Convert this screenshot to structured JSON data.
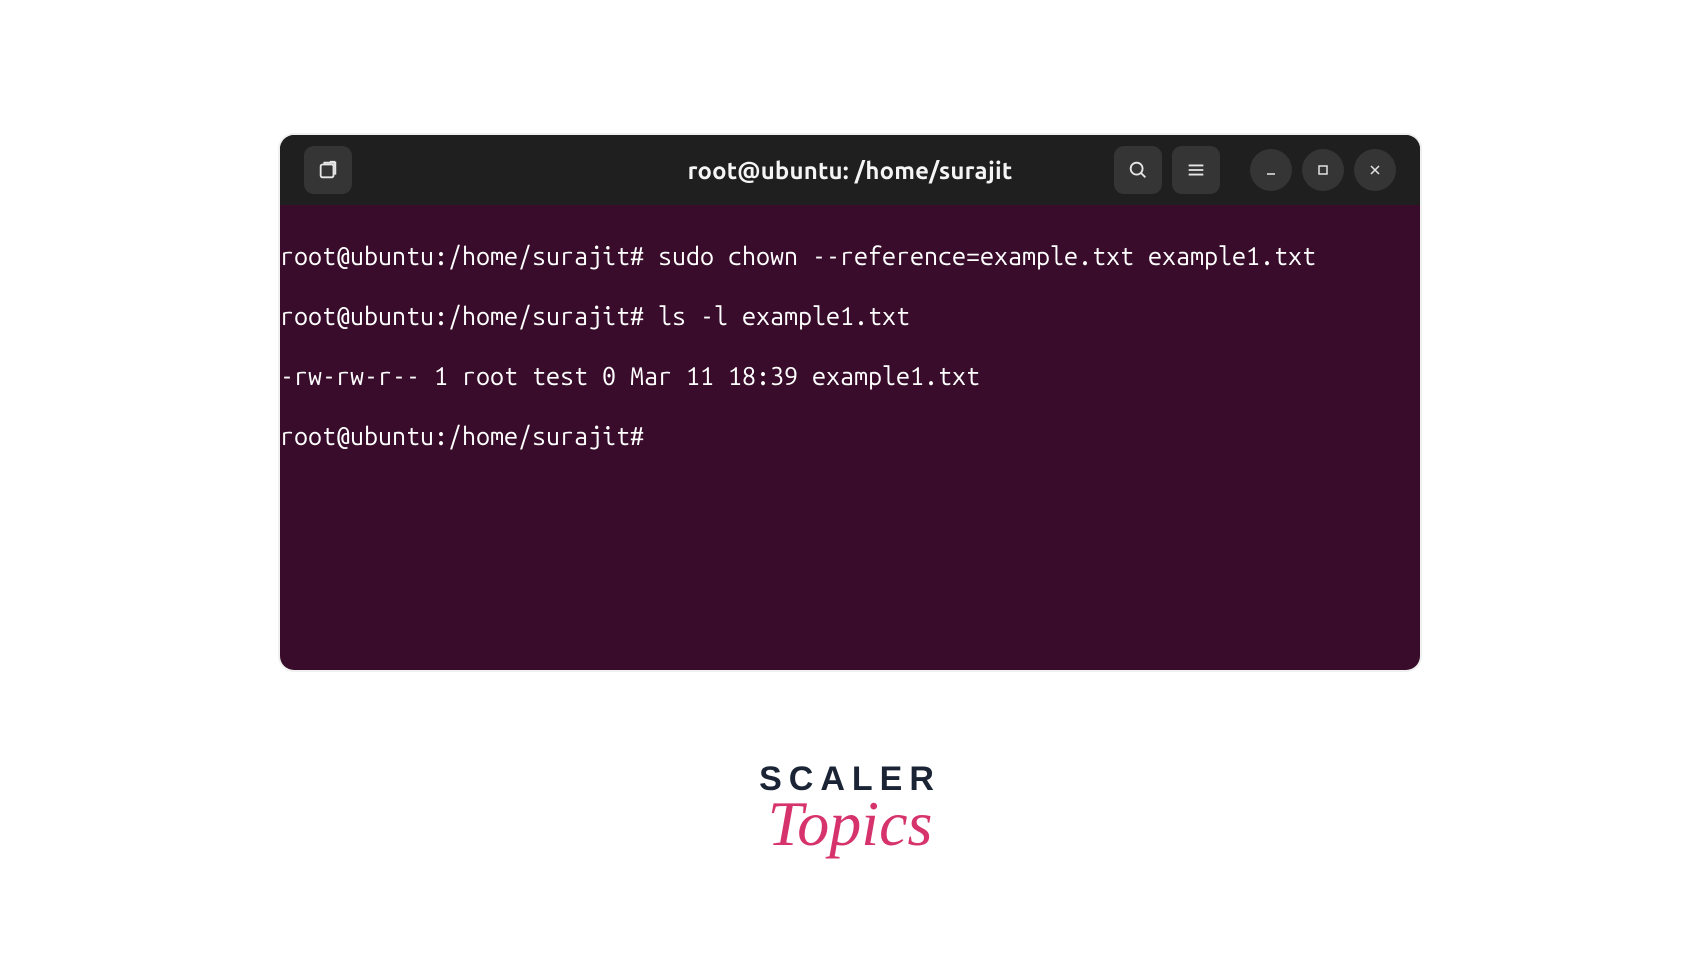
{
  "titlebar": {
    "title": "root@ubuntu: /home/surajit",
    "icons": {
      "new_tab": "new-tab-icon",
      "search": "search-icon",
      "menu": "hamburger-icon",
      "minimize": "minimize-icon",
      "maximize": "maximize-icon",
      "close": "close-icon"
    }
  },
  "terminal": {
    "lines": [
      "root@ubuntu:/home/surajit# sudo chown --reference=example.txt example1.txt",
      "root@ubuntu:/home/surajit# ls -l example1.txt",
      "-rw-rw-r-- 1 root test 0 Mar 11 18:39 example1.txt",
      "root@ubuntu:/home/surajit#"
    ]
  },
  "logo": {
    "line1": "SCALER",
    "line2": "Topics"
  },
  "colors": {
    "terminal_bg": "#380c2a",
    "titlebar_bg": "#1f1f1f",
    "button_bg": "#353535",
    "text_fg": "#ffffff",
    "logo_dark": "#1b2435",
    "logo_pink": "#d6336c"
  }
}
